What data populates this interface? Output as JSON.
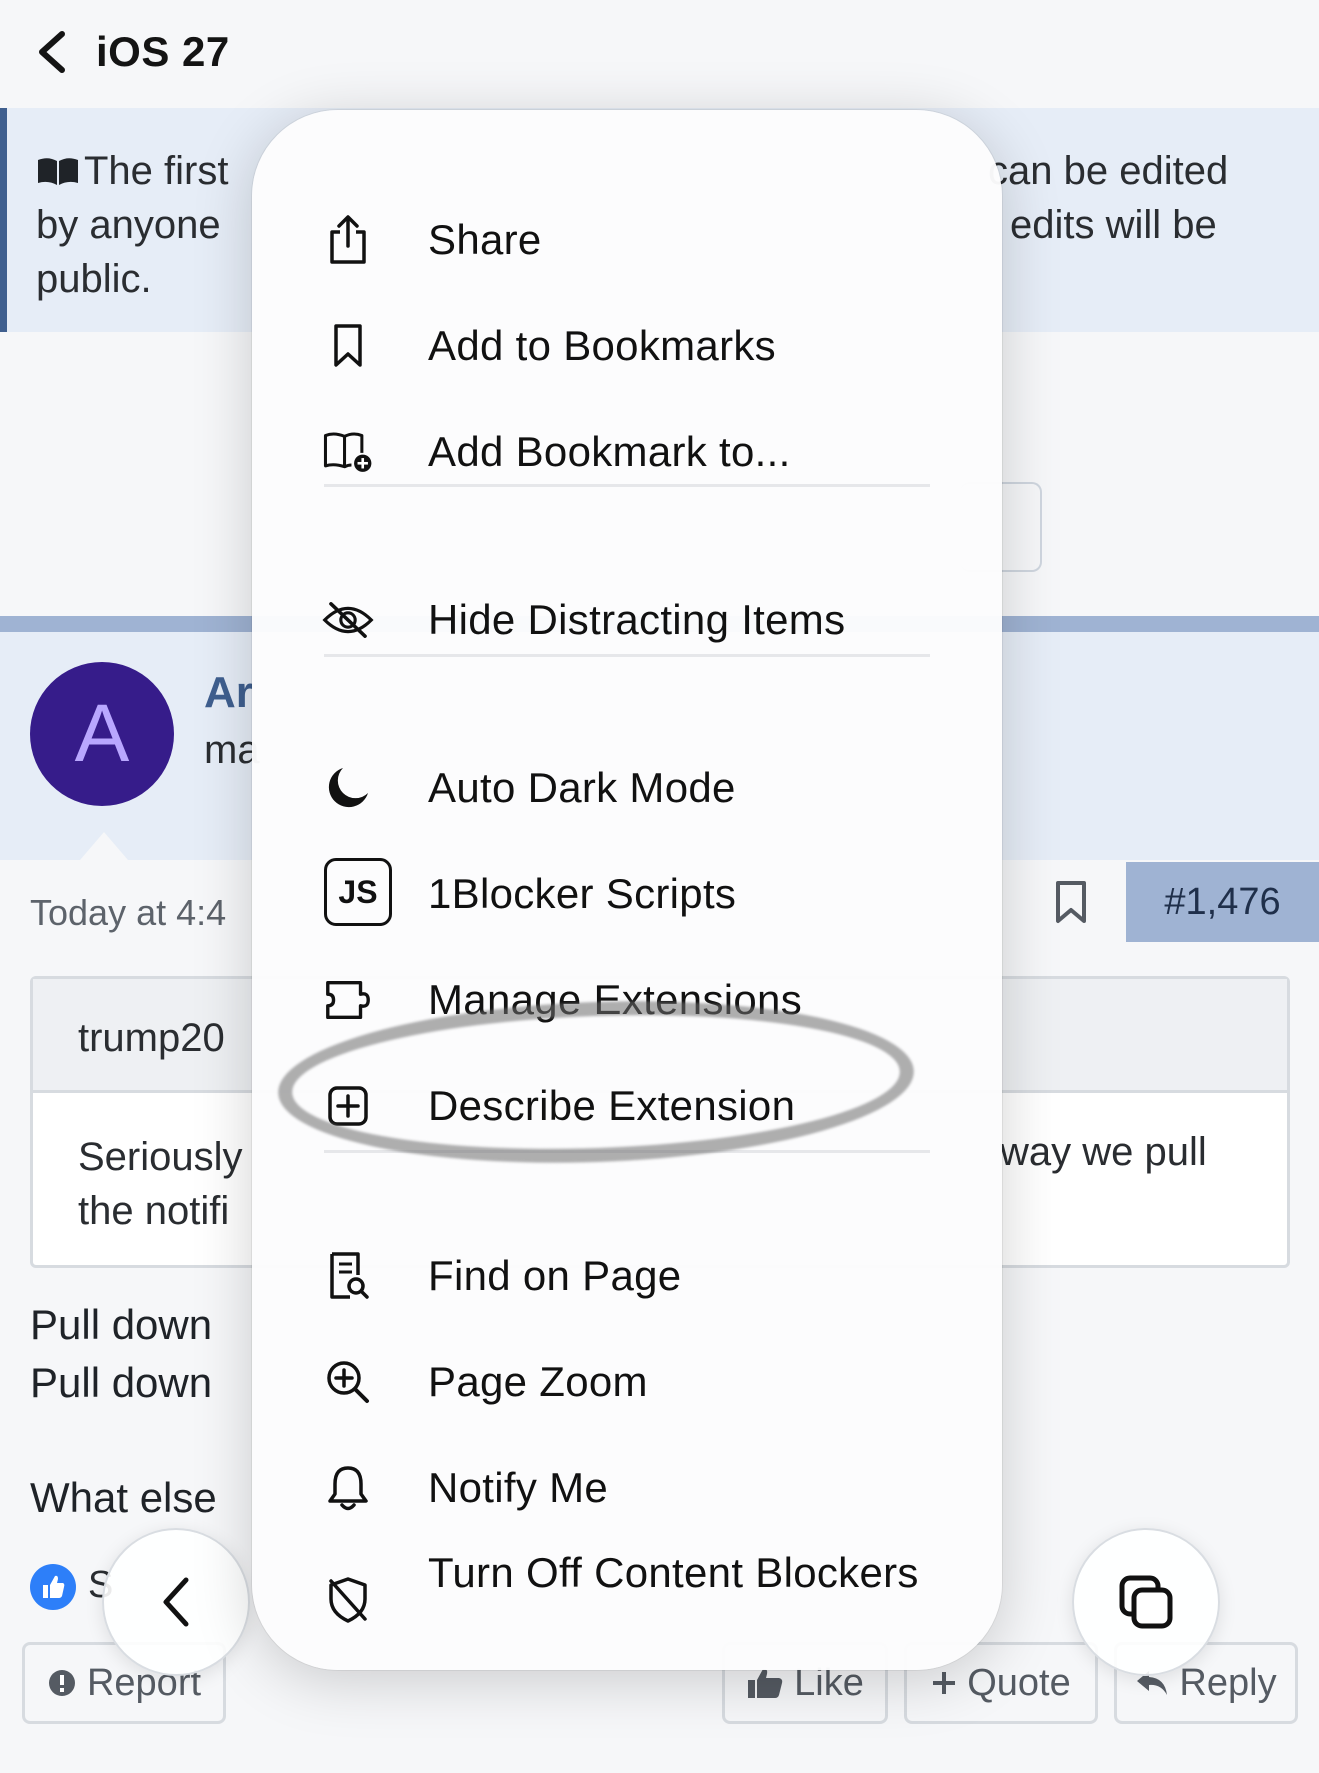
{
  "header": {
    "title": "iOS 27"
  },
  "notice": {
    "line1": "The first",
    "line2": "by anyone",
    "line3": "public.",
    "right1": "can be edited",
    "right2": "edits will be"
  },
  "author": {
    "avatar_letter": "A",
    "name": "Ar",
    "meta": "ma"
  },
  "post": {
    "date": "Today at 4:4",
    "number": "#1,476",
    "quote_user": "trump20",
    "quote_line1": "Seriously",
    "quote_line2": "the notifi",
    "quote_right": "way we pull",
    "body_line1": "Pull down",
    "body_line2": "Pull down",
    "body_question": "What else",
    "reaction_text": "S"
  },
  "actions": {
    "report": "Report",
    "like": "Like",
    "quote": "Quote",
    "reply": "Reply"
  },
  "menu": {
    "items": [
      {
        "label": "Share",
        "icon": "share-icon"
      },
      {
        "label": "Add to Bookmarks",
        "icon": "bookmark-icon"
      },
      {
        "label": "Add Bookmark to...",
        "icon": "book-add-icon"
      },
      {
        "label": "Hide Distracting Items",
        "icon": "eye-slash-icon"
      },
      {
        "label": "Auto Dark Mode",
        "icon": "moon-icon"
      },
      {
        "label": "1Blocker Scripts",
        "icon": "js-icon"
      },
      {
        "label": "Manage Extensions",
        "icon": "puzzle-icon"
      },
      {
        "label": "Describe Extension",
        "icon": "plus-square-icon"
      },
      {
        "label": "Find on Page",
        "icon": "doc-search-icon"
      },
      {
        "label": "Page Zoom",
        "icon": "zoom-in-icon"
      },
      {
        "label": "Notify Me",
        "icon": "bell-icon"
      },
      {
        "label": "Turn Off Content Blockers",
        "icon": "shield-slash-icon"
      }
    ],
    "js_badge": "JS"
  },
  "colors": {
    "accent": "#3f5f8f",
    "notice_bg": "#e6edf7",
    "avatar_bg": "#361c8a",
    "post_number_bg": "#9fb3d3",
    "like_badge": "#2d7ff9"
  }
}
